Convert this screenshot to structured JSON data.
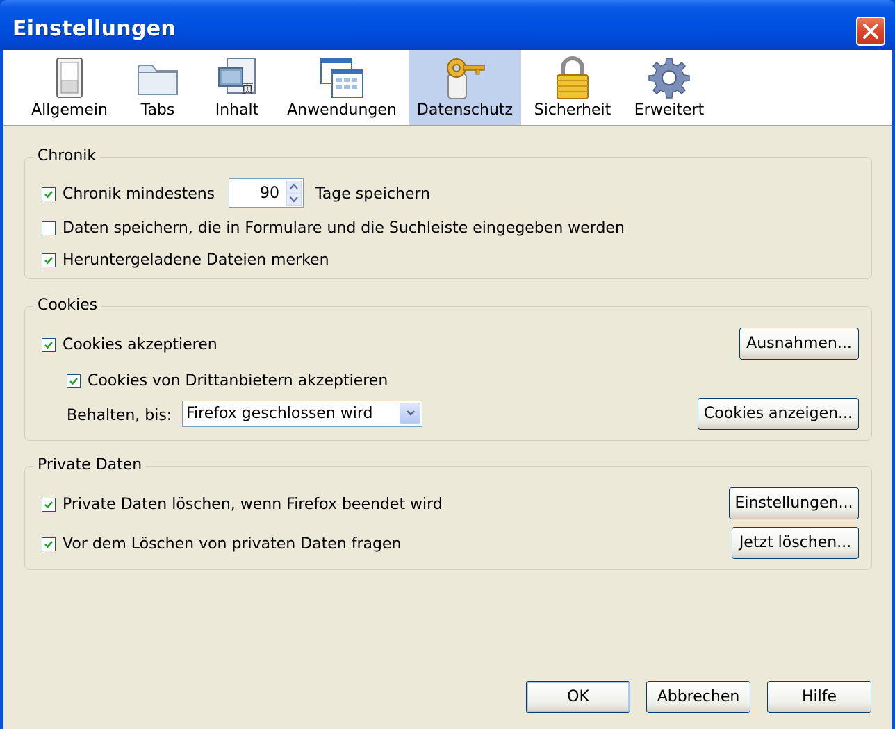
{
  "window": {
    "title": "Einstellungen"
  },
  "toolbar": {
    "tabs": [
      {
        "label": "Allgemein",
        "icon": "general-switch-icon",
        "selected": false
      },
      {
        "label": "Tabs",
        "icon": "tabs-folder-icon",
        "selected": false
      },
      {
        "label": "Inhalt",
        "icon": "content-page-icon",
        "selected": false
      },
      {
        "label": "Anwendungen",
        "icon": "applications-window-icon",
        "selected": false
      },
      {
        "label": "Datenschutz",
        "icon": "privacy-key-icon",
        "selected": true
      },
      {
        "label": "Sicherheit",
        "icon": "security-lock-icon",
        "selected": false
      },
      {
        "label": "Erweitert",
        "icon": "advanced-gear-icon",
        "selected": false
      }
    ]
  },
  "history": {
    "legend": "Chronik",
    "keep_history_label": "Chronik mindestens",
    "keep_history_checked": true,
    "days_value": "90",
    "days_suffix": "Tage speichern",
    "form_data_label": "Daten speichern, die in Formulare und die Suchleiste eingegeben werden",
    "form_data_checked": false,
    "downloads_label": "Heruntergeladene Dateien merken",
    "downloads_checked": true
  },
  "cookies": {
    "legend": "Cookies",
    "accept_label": "Cookies akzeptieren",
    "accept_checked": true,
    "exceptions_button": "Ausnahmen...",
    "third_party_label": "Cookies von Drittanbietern akzeptieren",
    "third_party_checked": true,
    "keep_until_label": "Behalten, bis:",
    "keep_until_value": "Firefox geschlossen wird",
    "show_cookies_button": "Cookies anzeigen..."
  },
  "private_data": {
    "legend": "Private Daten",
    "clear_on_exit_label": "Private Daten löschen, wenn Firefox beendet wird",
    "clear_on_exit_checked": true,
    "settings_button": "Einstellungen...",
    "ask_before_label": "Vor dem Löschen von privaten Daten fragen",
    "ask_before_checked": true,
    "clear_now_button": "Jetzt löschen..."
  },
  "footer": {
    "ok_button": "OK",
    "cancel_button": "Abbrechen",
    "help_button": "Hilfe"
  },
  "colors": {
    "titlebar": "#0051e0",
    "selected_tab": "#c1d2ee",
    "dialog_bg": "#ece9d8",
    "check_green": "#21a121",
    "close_red": "#d8452a"
  }
}
